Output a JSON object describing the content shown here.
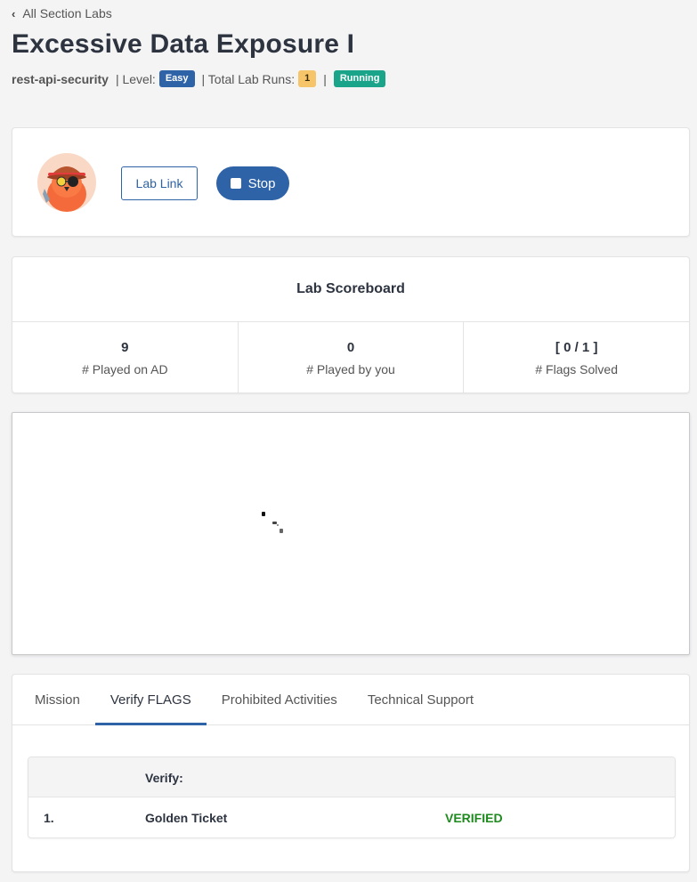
{
  "nav": {
    "back_label": "All Section Labs"
  },
  "header": {
    "title": "Excessive Data Exposure I",
    "category": "rest-api-security",
    "level_label": "| Level:",
    "level": "Easy",
    "runs_label": "| Total Lab Runs:",
    "runs": "1",
    "sep": "|",
    "status": "Running"
  },
  "actions": {
    "lab_link_label": "Lab Link",
    "stop_label": "Stop"
  },
  "scoreboard": {
    "title": "Lab Scoreboard",
    "stats": [
      {
        "value": "9",
        "label": "# Played on AD"
      },
      {
        "value": "0",
        "label": "# Played by you"
      },
      {
        "value": "[ 0 / 1 ]",
        "label": "# Flags Solved"
      }
    ]
  },
  "tabs": [
    {
      "label": "Mission"
    },
    {
      "label": "Verify FLAGS"
    },
    {
      "label": "Prohibited Activities"
    },
    {
      "label": "Technical Support"
    }
  ],
  "active_tab": "Verify FLAGS",
  "verify": {
    "header": "Verify:",
    "rows": [
      {
        "num": "1.",
        "name": "Golden Ticket",
        "status": "VERIFIED"
      }
    ]
  },
  "colors": {
    "accent": "#2f63a8",
    "running": "#1aa58a",
    "count": "#f6c469",
    "verified": "#1e8a1e"
  }
}
